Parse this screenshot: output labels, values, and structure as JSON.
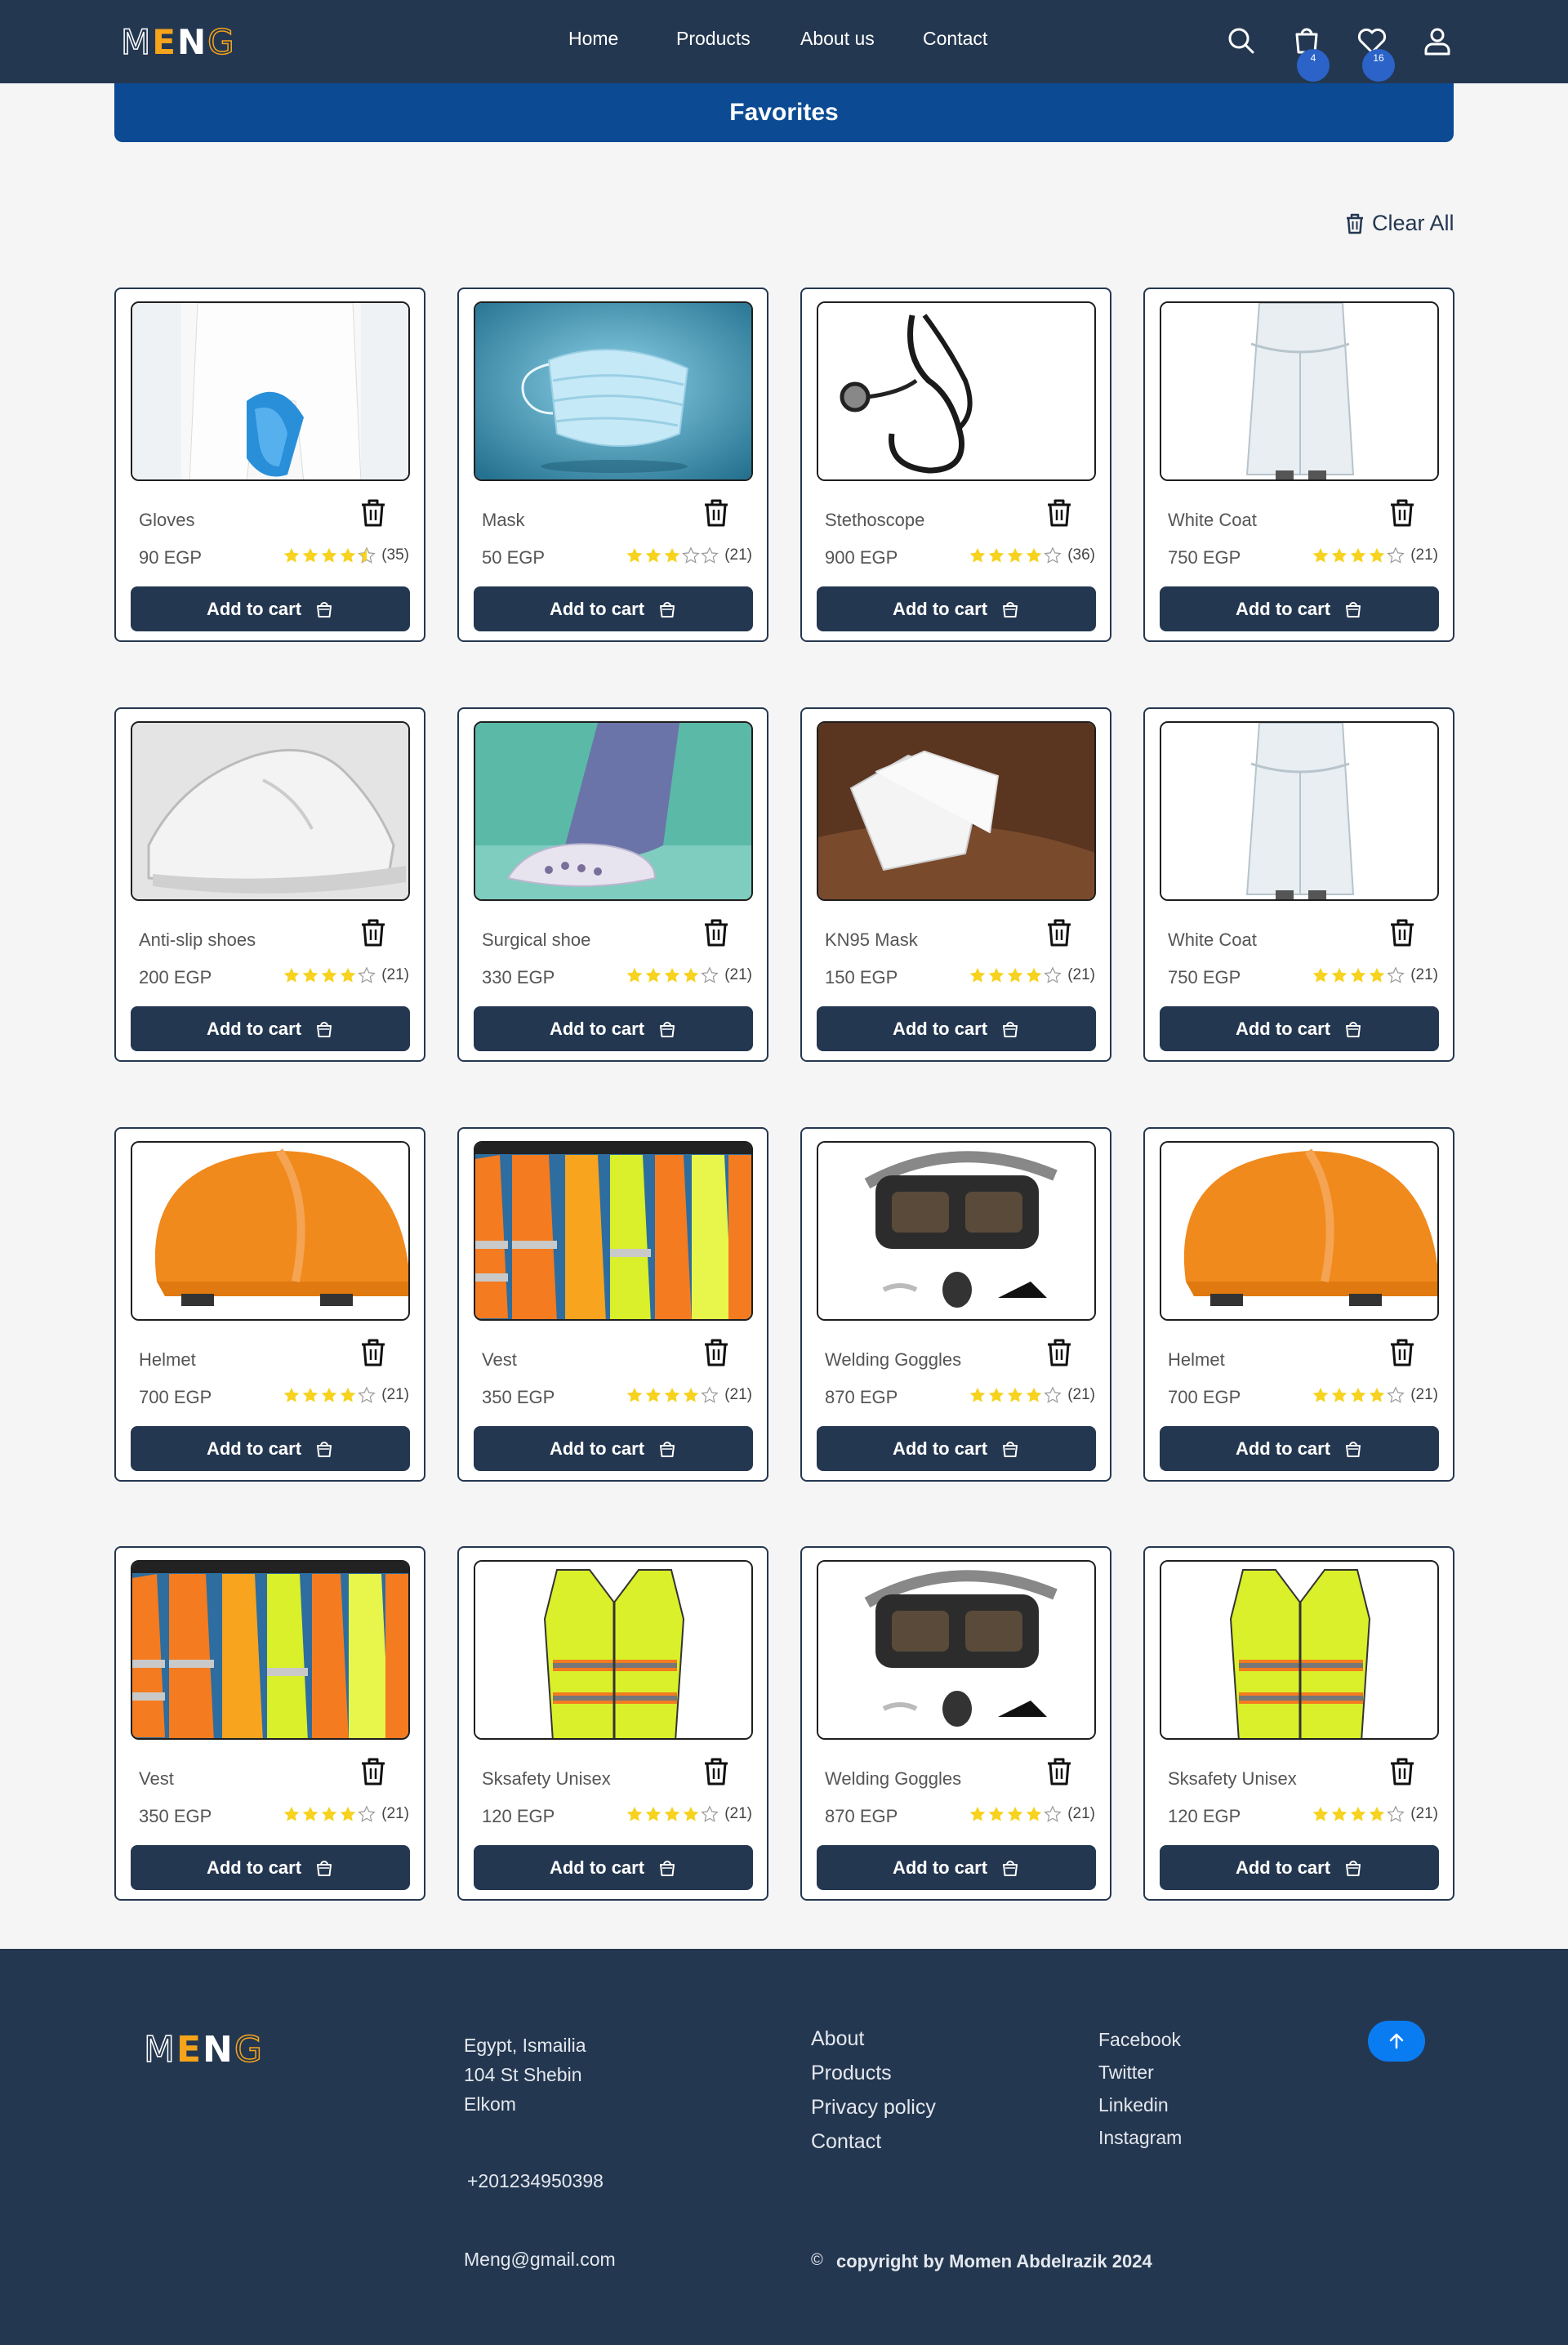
{
  "brand": {
    "logo_letters": [
      "M",
      "E",
      "N",
      "G"
    ]
  },
  "nav": {
    "links": [
      "Home",
      "Products",
      "About us",
      "Contact"
    ],
    "cart_count": "4",
    "favorites_count": "16"
  },
  "page": {
    "title": "Favorites",
    "clear_all": "Clear All"
  },
  "products": [
    {
      "name": "Gloves",
      "price": "90 EGP",
      "rating": 4.5,
      "count": "(35)",
      "img": "gloves"
    },
    {
      "name": "Mask",
      "price": "50 EGP",
      "rating": 3,
      "count": "(21)",
      "img": "mask"
    },
    {
      "name": "Stethoscope",
      "price": "900 EGP",
      "rating": 4,
      "count": "(36)",
      "img": "stethoscope"
    },
    {
      "name": "White Coat",
      "price": "750 EGP",
      "rating": 4,
      "count": "(21)",
      "img": "coat"
    },
    {
      "name": "Anti-slip shoes",
      "price": "200 EGP",
      "rating": 4,
      "count": "(21)",
      "img": "shoe"
    },
    {
      "name": "Surgical shoe",
      "price": "330 EGP",
      "rating": 4,
      "count": "(21)",
      "img": "clog"
    },
    {
      "name": "KN95 Mask",
      "price": "150 EGP",
      "rating": 4,
      "count": "(21)",
      "img": "kn95"
    },
    {
      "name": "White Coat",
      "price": "750 EGP",
      "rating": 4,
      "count": "(21)",
      "img": "coat"
    },
    {
      "name": "Helmet",
      "price": "700 EGP",
      "rating": 4,
      "count": "(21)",
      "img": "helmet"
    },
    {
      "name": "Vest",
      "price": "350 EGP",
      "rating": 4,
      "count": "(21)",
      "img": "vests"
    },
    {
      "name": "Welding Goggles",
      "price": "870 EGP",
      "rating": 4,
      "count": "(21)",
      "img": "goggles"
    },
    {
      "name": "Helmet",
      "price": "700 EGP",
      "rating": 4,
      "count": "(21)",
      "img": "helmet"
    },
    {
      "name": "Vest",
      "price": "350 EGP",
      "rating": 4,
      "count": "(21)",
      "img": "vests"
    },
    {
      "name": "Sksafety Unisex",
      "price": "120 EGP",
      "rating": 4,
      "count": "(21)",
      "img": "vest"
    },
    {
      "name": "Welding Goggles",
      "price": "870 EGP",
      "rating": 4,
      "count": "(21)",
      "img": "goggles"
    },
    {
      "name": "Sksafety Unisex",
      "price": "120 EGP",
      "rating": 4,
      "count": "(21)",
      "img": "vest"
    }
  ],
  "card": {
    "add_to_cart": "Add to cart"
  },
  "footer": {
    "address": [
      "Egypt, Ismailia",
      "104 St Shebin",
      "Elkom"
    ],
    "phone": "+201234950398",
    "email": "Meng@gmail.com",
    "links": [
      "About",
      "Products",
      "Privacy policy",
      "Contact"
    ],
    "social": [
      "Facebook",
      "Twitter",
      "Linkedin",
      "Instagram"
    ],
    "copyright_symbol": "©",
    "copyright": "copyright by Momen Abdelrazik 2024"
  },
  "colors": {
    "navy": "#243750",
    "banner": "#0c4a93",
    "star": "#f7d21e",
    "accent": "#f5a41b",
    "scroll_top": "#0a7cf2"
  },
  "icons": [
    "search-icon",
    "cart-icon",
    "heart-icon",
    "user-icon",
    "trash-icon",
    "star-icon",
    "arrow-up-icon"
  ]
}
